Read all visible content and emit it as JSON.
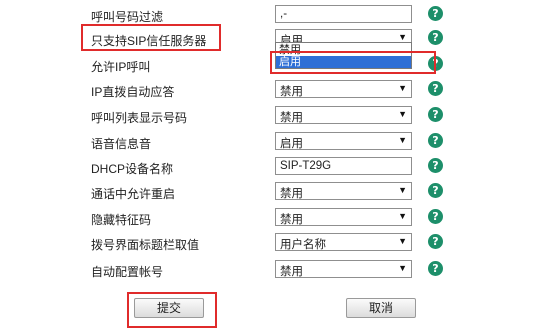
{
  "rows": [
    {
      "label": "呼叫号码过滤",
      "type": "input",
      "value": ",-"
    },
    {
      "label": "只支持SIP信任服务器",
      "type": "select",
      "value": "启用"
    },
    {
      "label": "允许IP呼叫",
      "type": "select",
      "value": ""
    },
    {
      "label": "IP直拨自动应答",
      "type": "select",
      "value": "禁用"
    },
    {
      "label": "呼叫列表显示号码",
      "type": "select",
      "value": "禁用"
    },
    {
      "label": "语音信息音",
      "type": "select",
      "value": "启用"
    },
    {
      "label": "DHCP设备名称",
      "type": "input",
      "value": "SIP-T29G"
    },
    {
      "label": "通话中允许重启",
      "type": "select",
      "value": "禁用"
    },
    {
      "label": "隐藏特征码",
      "type": "select",
      "value": "禁用"
    },
    {
      "label": "拨号界面标题栏取值",
      "type": "select",
      "value": "用户名称"
    },
    {
      "label": "自动配置帐号",
      "type": "select",
      "value": "禁用"
    }
  ],
  "dropdown": {
    "options": [
      "禁用",
      "启用"
    ],
    "selected": "启用"
  },
  "help_glyph": "?",
  "arrow_glyph": "▼",
  "buttons": {
    "submit": "提交",
    "cancel": "取消"
  },
  "colors": {
    "help_icon": "#1d8f6a",
    "highlight": "#e02b2b",
    "selected_option": "#2f6fd6"
  }
}
